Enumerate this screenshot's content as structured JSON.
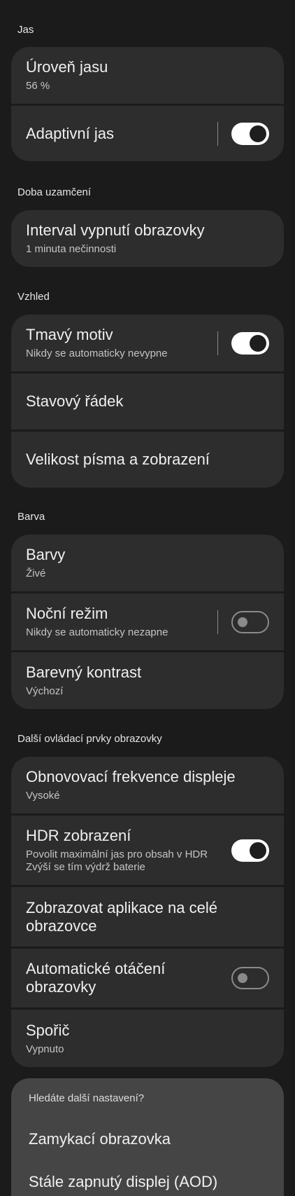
{
  "sections": {
    "brightness": {
      "header": "Jas",
      "level": {
        "title": "Úroveň jasu",
        "subtitle": "56 %"
      },
      "adaptive": {
        "title": "Adaptivní jas",
        "enabled": true
      }
    },
    "lock": {
      "header": "Doba uzamčení",
      "timeout": {
        "title": "Interval vypnutí obrazovky",
        "subtitle": "1 minuta nečinnosti"
      }
    },
    "appearance": {
      "header": "Vzhled",
      "dark": {
        "title": "Tmavý motiv",
        "subtitle": "Nikdy se automaticky nevypne",
        "enabled": true
      },
      "statusbar": {
        "title": "Stavový řádek"
      },
      "fontsize": {
        "title": "Velikost písma a zobrazení"
      }
    },
    "color": {
      "header": "Barva",
      "colors": {
        "title": "Barvy",
        "subtitle": "Živé"
      },
      "night": {
        "title": "Noční režim",
        "subtitle": "Nikdy se automaticky nezapne",
        "enabled": false
      },
      "contrast": {
        "title": "Barevný kontrast",
        "subtitle": "Výchozí"
      }
    },
    "more_controls": {
      "header": "Další ovládací prvky obrazovky",
      "refresh": {
        "title": "Obnovovací frekvence displeje",
        "subtitle": "Vysoké"
      },
      "hdr": {
        "title": "HDR zobrazení",
        "subtitle_line1": "Povolit maximální jas pro obsah v HDR",
        "subtitle_line2": "Zvýší se tím výdrž baterie",
        "enabled": true
      },
      "fullscreen": {
        "title_line1": "Zobrazovat aplikace na celé",
        "title_line2": "obrazovce"
      },
      "rotate": {
        "title_line1": "Automatické otáčení",
        "title_line2": "obrazovky",
        "enabled": false
      },
      "saver": {
        "title": "Spořič",
        "subtitle": "Vypnuto"
      }
    }
  },
  "more_settings": {
    "header": "Hledáte další nastavení?",
    "links": [
      "Zamykací obrazovka",
      "Stále zapnutý displej (AOD)"
    ]
  },
  "colors": {
    "background": "#1b1b1b",
    "card": "#2d2d2d",
    "toggle_on": "#ffffff",
    "panel": "#454545"
  }
}
